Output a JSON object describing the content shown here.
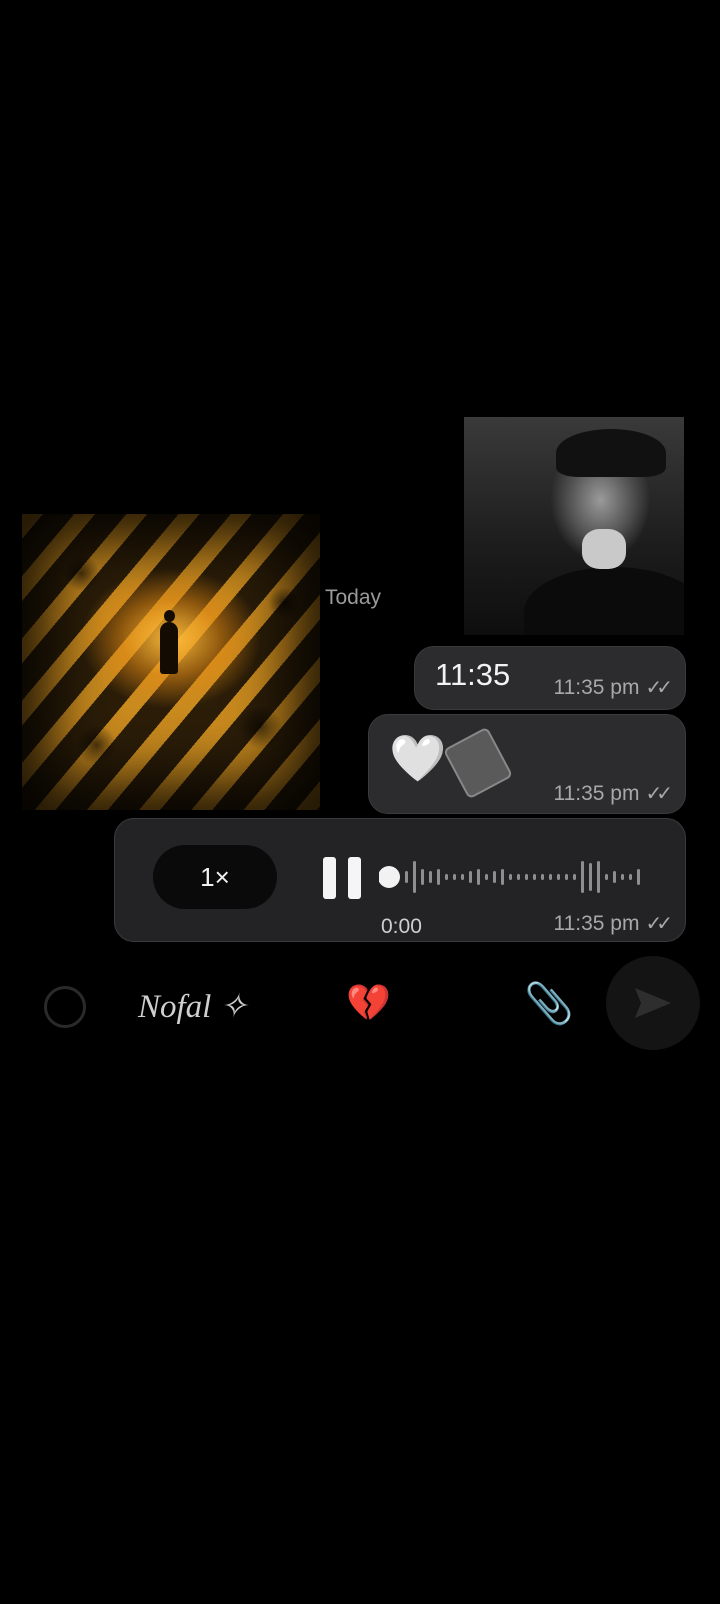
{
  "chat": {
    "date_label": "Today",
    "messages": [
      {
        "type": "text",
        "text": "11:35",
        "time": "11:35 pm"
      },
      {
        "type": "emoji",
        "emoji": "🤍",
        "time": "11:35 pm"
      },
      {
        "type": "voice",
        "speed": "1×",
        "position": "0:00",
        "time": "11:35 pm"
      }
    ]
  },
  "input_bar": {
    "text": "Nofal ✧",
    "heart_glyph": "💔",
    "clip_glyph": "📎"
  },
  "icons": {
    "read_ticks": "✓✓",
    "sticker": "sticker-icon",
    "send": "send-icon",
    "pause": "pause-icon"
  },
  "colors": {
    "bubble": "#2c2c2e",
    "background": "#000000"
  }
}
